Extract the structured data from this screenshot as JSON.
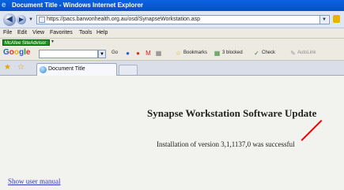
{
  "window": {
    "title": "Document Title - Windows Internet Explorer"
  },
  "address_bar": {
    "url": "https://pacs.barwonhealth.org.au/osd/SynapseWorkstation.asp"
  },
  "menu": {
    "items": [
      "File",
      "Edit",
      "View",
      "Favorites",
      "Tools",
      "Help"
    ]
  },
  "mcafee": {
    "label": "McAfee SiteAdvisor"
  },
  "google_toolbar": {
    "logo": "Google",
    "go_label": "Go",
    "bookmarks_label": "Bookmarks",
    "blocked_label": "3 blocked",
    "check_label": "Check",
    "autolink_label": "AutoLink"
  },
  "tabs": [
    {
      "label": "Document Title"
    }
  ],
  "page": {
    "heading": "Synapse Workstation Software Update",
    "message": "Installation of version 3,1,1137,0 was successful",
    "link_text": "Show user manual"
  },
  "colors": {
    "titlebar": "#0a4fc7",
    "link": "#2f3bbf",
    "annotation": "#ee0000"
  }
}
